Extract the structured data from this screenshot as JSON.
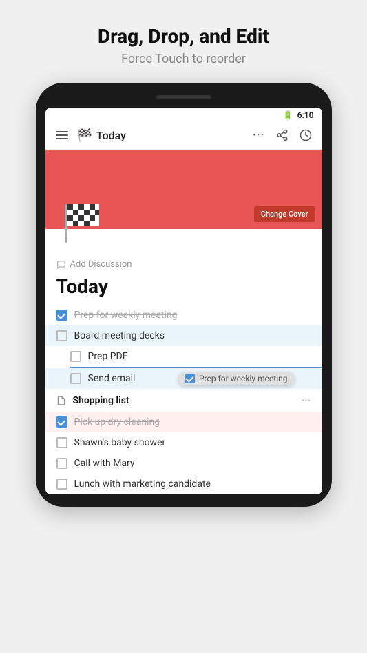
{
  "promo": {
    "title": "Drag, Drop, and Edit",
    "subtitle": "Force Touch to reorder"
  },
  "status_bar": {
    "battery_icon": "🔋",
    "time": "6:10"
  },
  "app_bar": {
    "title": "Today",
    "menu_icon": "hamburger",
    "flag_emoji": "🏁",
    "more_icon": "•••",
    "share_icon": "share",
    "clock_icon": "clock"
  },
  "cover": {
    "color": "#e85555",
    "change_cover_label": "Change Cover"
  },
  "content": {
    "add_discussion_label": "Add Discussion",
    "page_title": "Today",
    "tasks": [
      {
        "id": 1,
        "text": "Prep for weekly meeting",
        "checked": true,
        "completed": true,
        "level": 0
      },
      {
        "id": 2,
        "text": "Board meeting decks",
        "checked": false,
        "completed": false,
        "level": 0,
        "highlighted": true
      },
      {
        "id": 3,
        "text": "Prep PDF",
        "checked": false,
        "completed": false,
        "level": 1,
        "highlighted": false
      },
      {
        "id": 4,
        "text": "Send email",
        "checked": false,
        "completed": false,
        "level": 1,
        "highlighted": true,
        "dragging_item": "Prep for weekly meeting"
      },
      {
        "id": 5,
        "type": "section",
        "text": "Shopping list"
      },
      {
        "id": 6,
        "text": "Pick up dry cleaning",
        "checked": true,
        "completed": true,
        "level": 0,
        "pickup": true
      },
      {
        "id": 7,
        "text": "Shawn's baby shower",
        "checked": false,
        "completed": false,
        "level": 0
      },
      {
        "id": 8,
        "text": "Call with Mary",
        "checked": false,
        "completed": false,
        "level": 0
      },
      {
        "id": 9,
        "text": "Lunch with marketing candidate",
        "checked": false,
        "completed": false,
        "level": 0
      }
    ]
  }
}
